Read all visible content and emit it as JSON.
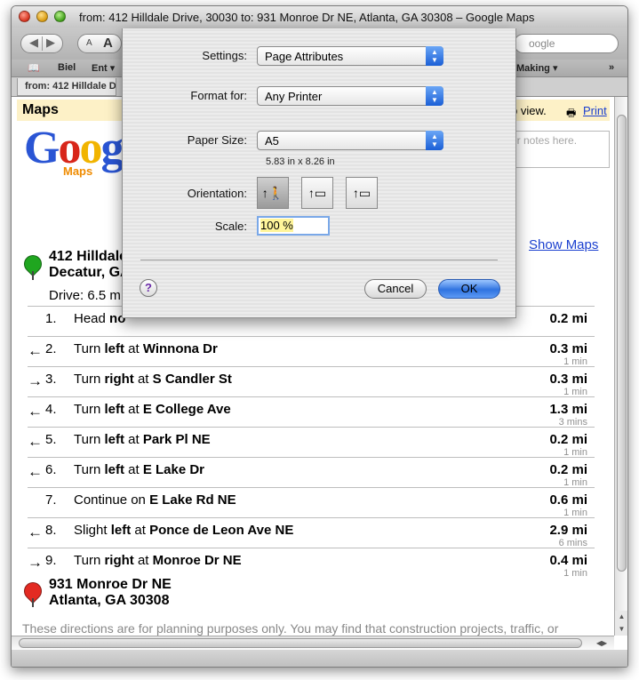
{
  "window": {
    "title": "from: 412 Hilldale Drive, 30030 to: 931 Monroe Dr NE, Atlanta, GA 30308 – Google Maps"
  },
  "toolbar": {
    "font_small": "A",
    "font_big": "A",
    "search_text": "oogle"
  },
  "bookmarks": [
    "Biel",
    "Ent ▾",
    "Making ▾"
  ],
  "tab": {
    "label": "from: 412 Hilldale D"
  },
  "page": {
    "header": "Maps",
    "map_view_text": "p view.",
    "print_link": "Print",
    "logo": {
      "letters": [
        "G",
        "o",
        "o",
        "g"
      ],
      "maps_label": "Maps"
    },
    "notes_placeholder": "er notes here.",
    "show_maps": "Show Maps",
    "start": {
      "line1": "412 Hilldale",
      "line2": "Decatur, GA"
    },
    "drive": "Drive: 6.5 m",
    "steps": [
      {
        "arrow": "",
        "num": "1.",
        "text_html": "Head <b>no</b>",
        "distance": "0.2 mi",
        "time": ""
      },
      {
        "arrow": "←",
        "num": "2.",
        "text_html": "Turn <b>left</b> at <b>Winnona Dr</b>",
        "distance": "0.3 mi",
        "time": "1 min"
      },
      {
        "arrow": "→",
        "num": "3.",
        "text_html": "Turn <b>right</b> at <b>S Candler St</b>",
        "distance": "0.3 mi",
        "time": "1 min"
      },
      {
        "arrow": "←",
        "num": "4.",
        "text_html": "Turn <b>left</b> at <b>E College Ave</b>",
        "distance": "1.3 mi",
        "time": "3 mins"
      },
      {
        "arrow": "←",
        "num": "5.",
        "text_html": "Turn <b>left</b> at <b>Park Pl NE</b>",
        "distance": "0.2 mi",
        "time": "1 min"
      },
      {
        "arrow": "←",
        "num": "6.",
        "text_html": "Turn <b>left</b> at <b>E Lake Dr</b>",
        "distance": "0.2 mi",
        "time": "1 min"
      },
      {
        "arrow": "",
        "num": "7.",
        "text_html": "Continue on <b>E Lake Rd NE</b>",
        "distance": "0.6 mi",
        "time": "1 min"
      },
      {
        "arrow": "←",
        "num": "8.",
        "text_html": "Slight <b>left</b> at <b>Ponce de Leon Ave NE</b>",
        "distance": "2.9 mi",
        "time": "6 mins"
      },
      {
        "arrow": "→",
        "num": "9.",
        "text_html": "Turn <b>right</b> at <b>Monroe Dr NE</b>",
        "distance": "0.4 mi",
        "time": "1 min"
      }
    ],
    "end": {
      "line1": "931 Monroe Dr NE",
      "line2": "Atlanta, GA 30308"
    },
    "disclaimer": "These directions are for planning purposes only. You may find that construction projects, traffic, or"
  },
  "print_sheet": {
    "settings_label": "Settings:",
    "settings_value": "Page Attributes",
    "format_label": "Format for:",
    "format_value": "Any Printer",
    "paper_label": "Paper Size:",
    "paper_value": "A5",
    "paper_dims": "5.83 in x 8.26 in",
    "orientation_label": "Orientation:",
    "scale_label": "Scale:",
    "scale_value": "100 %",
    "help_label": "?",
    "cancel_label": "Cancel",
    "ok_label": "OK"
  },
  "colors": {
    "maps_header_bg": "#fdf1c7",
    "link": "#1a3fcf",
    "default_button": "#2f73e0",
    "start_pin": "#1fa61f",
    "end_pin": "#e32a22"
  }
}
